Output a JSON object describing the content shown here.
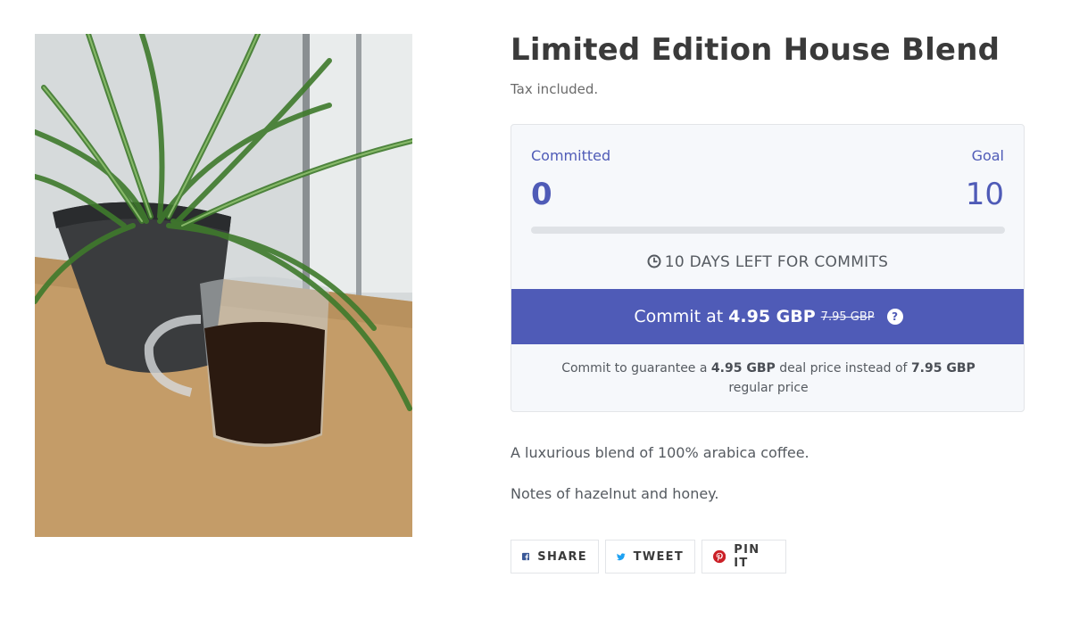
{
  "product": {
    "title": "Limited Edition House Blend",
    "tax_note": "Tax included.",
    "image_alt": "coffee-and-plant-photo"
  },
  "commit": {
    "committed_label": "Committed",
    "committed_value": "0",
    "goal_label": "Goal",
    "goal_value": "10",
    "progress_fraction": 0,
    "days_left": "10 DAYS LEFT FOR COMMITS",
    "button": {
      "prefix": "Commit at",
      "price": "4.95 GBP",
      "old_price": "7.95 GBP",
      "help": "?"
    },
    "note": {
      "t1": "Commit to guarantee a",
      "deal_price": "4.95 GBP",
      "t2": "deal price instead of",
      "regular_price": "7.95 GBP",
      "t3": "regular price"
    }
  },
  "description": {
    "line1": "A luxurious blend of 100% arabica coffee.",
    "line2": "Notes of hazelnut and honey."
  },
  "share": {
    "facebook": "SHARE",
    "twitter": "TWEET",
    "pinterest": "PIN IT"
  },
  "colors": {
    "accent": "#4f5bb7",
    "facebook": "#3b5998",
    "twitter": "#1da1f2",
    "pinterest": "#cb2027"
  },
  "icons": [
    "clock-icon",
    "help-icon",
    "facebook-icon",
    "twitter-icon",
    "pinterest-icon"
  ]
}
